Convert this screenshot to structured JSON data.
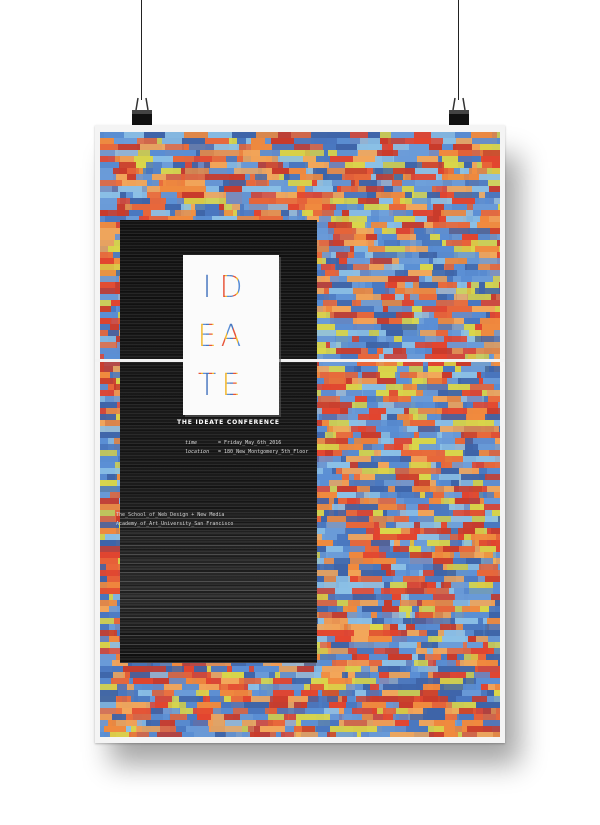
{
  "poster": {
    "logo_letters": [
      "I",
      "D",
      "",
      "E",
      "A",
      "",
      "T",
      "E",
      ""
    ],
    "conference_title": "THE IDEATE CONFERENCE",
    "details": [
      {
        "label": "time",
        "value": "= Friday_May_6th_2016"
      },
      {
        "label": "location",
        "value": "= 180_New_Montgomery_5th_Floor"
      }
    ],
    "school_line_1": "The_School_of_Web_Design + New Media",
    "school_line_2": "Academy_of_Art_University_San Francisco"
  },
  "colors": {
    "accent_orange": "#e8673a",
    "accent_blue": "#4a78c0",
    "accent_yellow": "#d9d64a",
    "panel_black": "#161616"
  }
}
